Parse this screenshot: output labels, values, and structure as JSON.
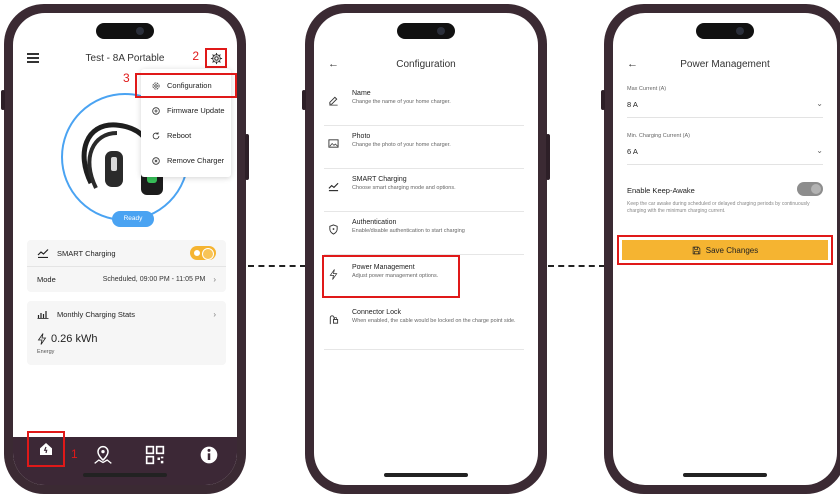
{
  "steps": {
    "one": "1",
    "two": "2",
    "three": "3"
  },
  "phone1": {
    "title": "Test - 8A Portable",
    "menu": [
      "Configuration",
      "Firmware Update",
      "Reboot",
      "Remove Charger"
    ],
    "status": "Ready",
    "smart_charging": "SMART Charging",
    "mode_label": "Mode",
    "mode_value": "Scheduled, 09:00 PM - 11:05 PM",
    "stats_title": "Monthly Charging Stats",
    "energy_value": "0.26 kWh",
    "energy_label": "Energy"
  },
  "phone2": {
    "title": "Configuration",
    "items": [
      {
        "title": "Name",
        "subtitle": "Change the name of your home charger."
      },
      {
        "title": "Photo",
        "subtitle": "Change the photo of your home charger."
      },
      {
        "title": "SMART Charging",
        "subtitle": "Choose smart charging mode and options."
      },
      {
        "title": "Authentication",
        "subtitle": "Enable/disable authentication to start charging"
      },
      {
        "title": "Power Management",
        "subtitle": "Adjust power management options."
      },
      {
        "title": "Connector Lock",
        "subtitle": "When enabled, the cable would be locked on the charge point side."
      }
    ]
  },
  "phone3": {
    "title": "Power Management",
    "max_current_label": "Max Current (A)",
    "max_current_value": "8 A",
    "min_current_label": "Min. Charging Current (A)",
    "min_current_value": "6 A",
    "keep_awake_label": "Enable Keep-Awake",
    "keep_awake_desc": "Keep the car awake during scheduled or delayed charging periods by continuously charging with the minimum charging current.",
    "save_label": "Save Changes"
  },
  "colors": {
    "accent": "#f5b431",
    "highlight": "#e01919",
    "ring": "#4aa3f2",
    "nav": "#3c2836"
  }
}
